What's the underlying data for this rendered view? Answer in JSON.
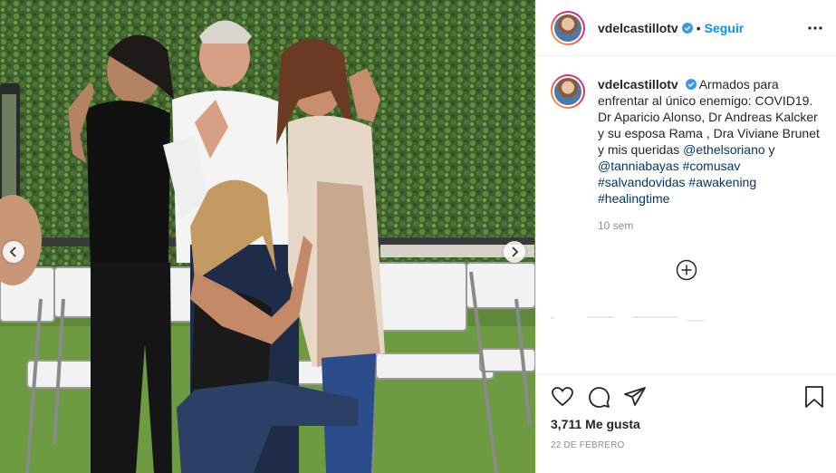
{
  "header": {
    "username": "vdelcastillotv",
    "separator": "•",
    "follow_label": "Seguir",
    "verified_icon": "verified-badge-icon",
    "more_icon": "more-options-icon"
  },
  "caption": {
    "username": "vdelcastillotv",
    "text_1": "Armados para enfrentar al único enemigo: COVID19. Dr Aparicio Alonso, Dr Andreas Kalcker y su esposa Rama , Dra Viviane Brunet y mis queridas ",
    "mention_1": "@ethelsoriano",
    "text_2": " y ",
    "mention_2": "@tanniabayas",
    "hashtags": [
      "#comusav",
      "#salvandovidas",
      "#awakening",
      "#healingtime"
    ],
    "time_ago": "10 sem"
  },
  "actions": {
    "likes_label": "3,711 Me gusta",
    "date_label": "22 DE FEBRERO",
    "icons": [
      "heart-icon",
      "comment-icon",
      "share-icon",
      "bookmark-icon"
    ]
  },
  "photo": {
    "alt": "Photo of five people posing in front of an ivy wall with white folding chairs",
    "nav_icons": [
      "chevron-left-icon",
      "chevron-right-icon"
    ]
  },
  "colors": {
    "accent": "#0095f6",
    "text": "#262626",
    "muted": "#8e8e8e",
    "link": "#00376b"
  }
}
